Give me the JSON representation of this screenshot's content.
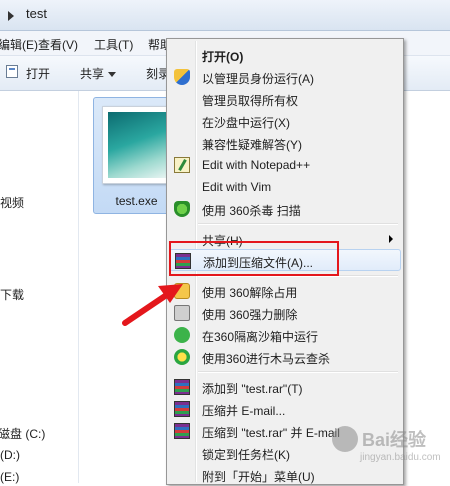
{
  "address": {
    "path": "test"
  },
  "menubar": [
    "编辑(E)",
    "查看(V)",
    "工具(T)",
    "帮助"
  ],
  "toolbar": {
    "open": "打开",
    "share": "共享",
    "burn": "刻录"
  },
  "nav": [
    "视频",
    "下载",
    "磁盘 (C:)",
    "(D:)",
    "(E:)"
  ],
  "file": {
    "name": "test.exe"
  },
  "context_menu": {
    "items": [
      {
        "label": "打开(O)",
        "icon": "none",
        "bold": true
      },
      {
        "label": "以管理员身份运行(A)",
        "icon": "uac-shield-icon"
      },
      {
        "label": "管理员取得所有权",
        "icon": "none"
      },
      {
        "label": "在沙盘中运行(X)",
        "icon": "none"
      },
      {
        "label": "兼容性疑难解答(Y)",
        "icon": "none"
      },
      {
        "label": "Edit with Notepad++",
        "icon": "notepad-plus-icon"
      },
      {
        "label": "Edit with Vim",
        "icon": "none"
      },
      {
        "label": "使用 360杀毒 扫描",
        "icon": "360-antivirus-icon"
      },
      {
        "label": "共享(H)",
        "icon": "none",
        "submenu": true
      },
      {
        "label": "添加到压缩文件(A)...",
        "icon": "winrar-icon",
        "highlighted": true
      },
      {
        "label": "使用 360解除占用",
        "icon": "360-unlock-icon"
      },
      {
        "label": "使用 360强力删除",
        "icon": "360-shred-icon"
      },
      {
        "label": "在360隔离沙箱中运行",
        "icon": "360-sandbox-icon"
      },
      {
        "label": "使用360进行木马云查杀",
        "icon": "360-trojan-icon"
      },
      {
        "label": "添加到 \"test.rar\"(T)",
        "icon": "winrar-icon"
      },
      {
        "label": "压缩并 E-mail...",
        "icon": "winrar-icon"
      },
      {
        "label": "压缩到 \"test.rar\" 并 E-mail",
        "icon": "winrar-icon"
      },
      {
        "label": "锁定到任务栏(K)",
        "icon": "none"
      },
      {
        "label": "附到「开始」菜单(U)",
        "icon": "none"
      }
    ]
  },
  "watermark": {
    "text": "Bai经验",
    "sub": "jingyan.baidu.com"
  },
  "colors": {
    "annotation_red": "#e4171c",
    "menu_bg": "#f0f0f0",
    "selection_blue": "#c3daf5"
  }
}
